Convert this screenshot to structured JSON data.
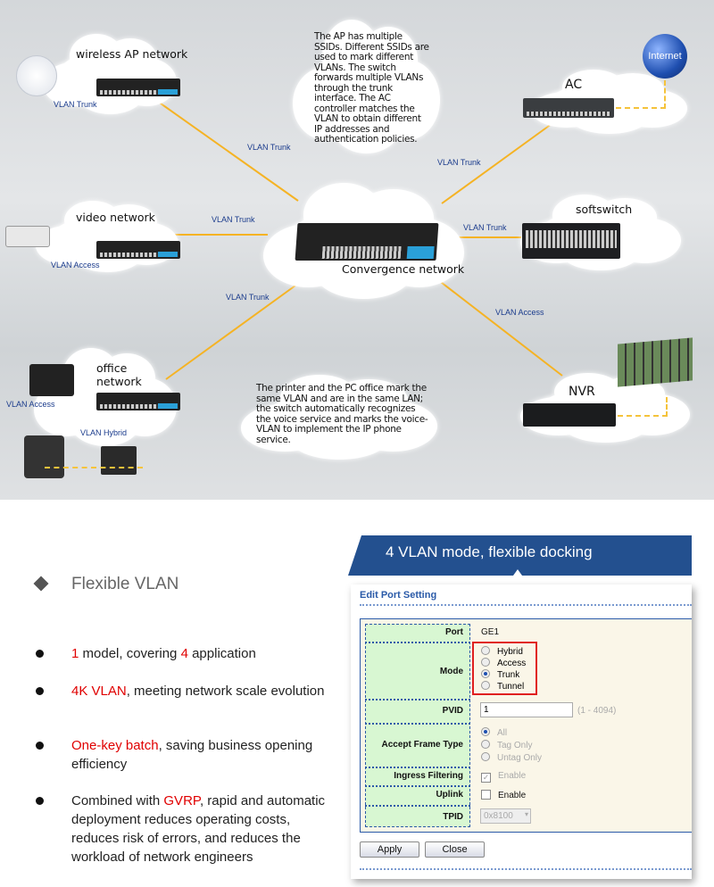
{
  "diagram": {
    "nodes": {
      "wireless_ap": "wireless AP network",
      "video": "video network",
      "office": "office network",
      "convergence": "Convergence network",
      "ac": "AC",
      "softswitch": "softswitch",
      "nvr": "NVR",
      "internet": "Internet"
    },
    "links": {
      "ap_local": "VLAN Trunk",
      "ap_core": "VLAN Trunk",
      "ac_core": "VLAN Trunk",
      "video_core": "VLAN Trunk",
      "softswitch_core": "VLAN Trunk",
      "office_core": "VLAN Trunk",
      "nvr_core": "VLAN Access",
      "video_local": "VLAN Access",
      "office_printer": "VLAN Access",
      "office_hybrid": "VLAN Hybrid"
    },
    "notes": {
      "ap": "The AP has multiple SSIDs. Different SSIDs are used to mark different VLANs. The switch forwards multiple VLANs through the trunk interface. The AC controller matches the VLAN to obtain different IP addresses and authentication policies.",
      "office": "The printer and the PC office mark the same VLAN and are in the same LAN; the switch automatically recognizes the voice service and marks the voice-VLAN to implement the IP phone service."
    },
    "link_color": "#f5b324"
  },
  "features": {
    "title": "Flexible VLAN",
    "bullets": [
      {
        "pre": "",
        "hl": "1",
        "mid": " model, covering ",
        "hl2": "4",
        "post": " application"
      },
      {
        "pre": "",
        "hl": "4K VLAN",
        "mid": ", meeting network scale evolution",
        "hl2": "",
        "post": ""
      },
      {
        "pre": "",
        "hl": "One-key batch",
        "mid": ", saving business opening efficiency",
        "hl2": "",
        "post": ""
      },
      {
        "pre": "Combined with ",
        "hl": "GVRP",
        "mid": ", rapid and automatic deployment reduces operating costs, reduces risk of errors, and reduces the workload of network engineers",
        "hl2": "",
        "post": ""
      }
    ],
    "highlight_color": "#e00000"
  },
  "banner": "4 VLAN mode, flexible docking",
  "port_setting": {
    "title": "Edit Port Setting",
    "port_label": "Port",
    "port_value": "GE1",
    "mode_label": "Mode",
    "mode_options": [
      "Hybrid",
      "Access",
      "Trunk",
      "Tunnel"
    ],
    "mode_selected": "Trunk",
    "pvid_label": "PVID",
    "pvid_value": "1",
    "pvid_range": "(1 - 4094)",
    "accept_label": "Accept Frame Type",
    "accept_options": [
      "All",
      "Tag Only",
      "Untag Only"
    ],
    "accept_selected": "All",
    "ingress_label": "Ingress Filtering",
    "ingress_option": "Enable",
    "ingress_checked": true,
    "uplink_label": "Uplink",
    "uplink_option": "Enable",
    "uplink_checked": false,
    "tpid_label": "TPID",
    "tpid_value": "0x8100",
    "apply": "Apply",
    "close": "Close"
  }
}
